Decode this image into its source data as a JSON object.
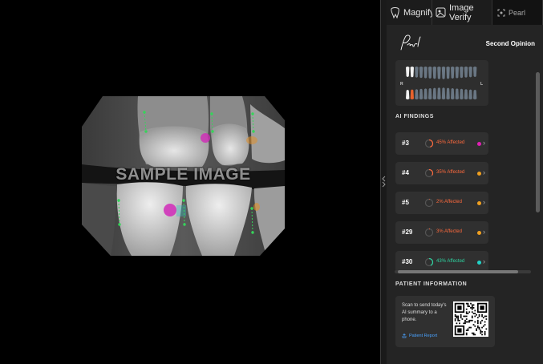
{
  "viewer": {
    "watermark": "SAMPLE IMAGE"
  },
  "toolbar": {
    "tools": [
      {
        "label": "Magnify",
        "icon": "tooth-magnify-icon"
      },
      {
        "label": "Image Verify",
        "icon": "image-verify-icon"
      },
      {
        "label": "Pearl",
        "icon": "pearl-frame-icon"
      }
    ]
  },
  "header": {
    "second_opinion_label": "Second Opinion"
  },
  "tooth_chart": {
    "labels": {
      "upper_left": "R",
      "right": "L"
    },
    "highlight_color": "#e8622c"
  },
  "findings": {
    "title": "AI FINDINGS",
    "items": [
      {
        "tooth": "#3",
        "affected_label": "45% Affected",
        "affected": 45,
        "text_color": "#ff6a3d",
        "ring_color": "#ff6a3d",
        "dot_color": "#e01fb5"
      },
      {
        "tooth": "#4",
        "affected_label": "35% Affected",
        "affected": 35,
        "text_color": "#ff6a3d",
        "ring_color": "#ff6a3d",
        "dot_color": "#f0a020"
      },
      {
        "tooth": "#5",
        "affected_label": "2% Affected",
        "affected": 2,
        "text_color": "#ff6a3d",
        "ring_color": "#ff6a3d",
        "dot_color": "#f0a020"
      },
      {
        "tooth": "#29",
        "affected_label": "3% Affected",
        "affected": 3,
        "text_color": "#ff6a3d",
        "ring_color": "#ff6a3d",
        "dot_color": "#f0a020"
      },
      {
        "tooth": "#30",
        "affected_label": "43% Affected",
        "affected": 43,
        "text_color": "#2ed3a0",
        "ring_color": "#2ed3a0",
        "dot_color": "#22d3c8"
      }
    ]
  },
  "patient_info": {
    "title": "PATIENT INFORMATION",
    "scan_text": "Scan to send today's AI summary to a phone.",
    "report_link": "Patient Report"
  }
}
